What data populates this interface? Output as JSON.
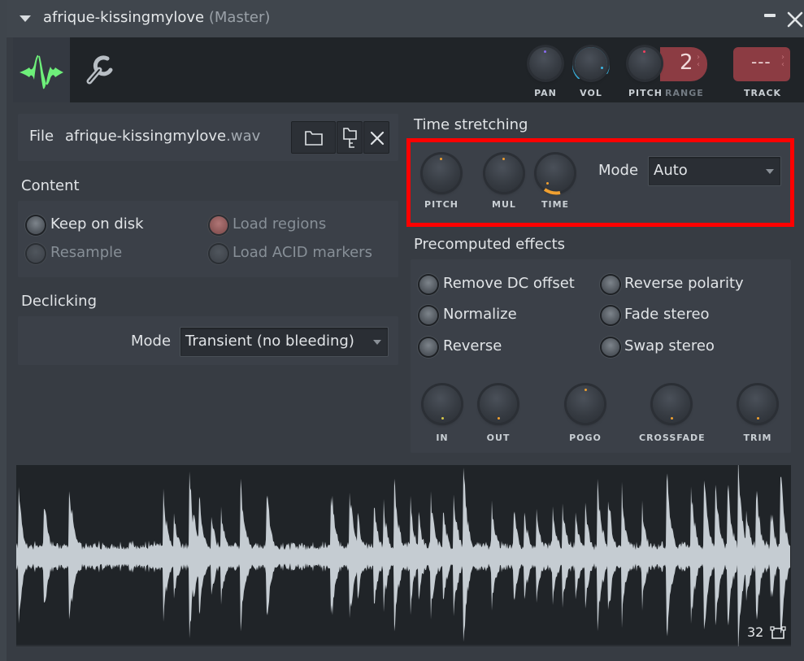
{
  "window": {
    "title": "afrique-kissingmylove",
    "title_suffix": "(Master)"
  },
  "toolbar": {
    "tabs": [
      {
        "name": "sample-tab",
        "icon": "waveform-icon",
        "active": true
      },
      {
        "name": "tools-tab",
        "icon": "wrench-icon",
        "active": false
      }
    ],
    "knobs": [
      {
        "label": "PAN",
        "value": 0
      },
      {
        "label": "VOL",
        "value": 0.78
      },
      {
        "label": "PITCH",
        "value": 0
      }
    ],
    "range_label": "RANGE",
    "range_value": "2",
    "track_label": "TRACK",
    "track_value": "---"
  },
  "file": {
    "label": "File",
    "name": "afrique-kissingmylove",
    "ext": ".wav",
    "buttons": [
      "open-folder",
      "browse-folder",
      "remove"
    ]
  },
  "content": {
    "title": "Content",
    "options": [
      {
        "label": "Keep on disk",
        "enabled": true,
        "checked": false
      },
      {
        "label": "Load regions",
        "enabled": false,
        "checked": true
      },
      {
        "label": "Resample",
        "enabled": false,
        "checked": false
      },
      {
        "label": "Load ACID markers",
        "enabled": false,
        "checked": false
      }
    ]
  },
  "declicking": {
    "title": "Declicking",
    "mode_label": "Mode",
    "mode_value": "Transient (no bleeding)"
  },
  "time_stretching": {
    "title": "Time stretching",
    "knobs": [
      {
        "label": "PITCH",
        "value": 0
      },
      {
        "label": "MUL",
        "value": 0
      },
      {
        "label": "TIME",
        "value": 0
      }
    ],
    "mode_label": "Mode",
    "mode_value": "Auto"
  },
  "precomputed": {
    "title": "Precomputed effects",
    "options": [
      {
        "label": "Remove DC offset",
        "checked": false
      },
      {
        "label": "Reverse polarity",
        "checked": false
      },
      {
        "label": "Normalize",
        "checked": false
      },
      {
        "label": "Fade stereo",
        "checked": false
      },
      {
        "label": "Reverse",
        "checked": false
      },
      {
        "label": "Swap stereo",
        "checked": false
      }
    ],
    "knobs": [
      {
        "label": "IN",
        "value": 0
      },
      {
        "label": "OUT",
        "value": 0
      },
      {
        "label": "POGO",
        "value": 0.5
      },
      {
        "label": "CROSSFADE",
        "value": 0
      },
      {
        "label": "TRIM",
        "value": 0
      }
    ]
  },
  "waveform": {
    "zoom_value": "32"
  },
  "colors": {
    "accent_green": "#6ef07a",
    "vol_ring": "#3bb8e6",
    "knob_dot": "#f0a030",
    "display_red": "#8c3c43",
    "highlight": "#ff0000"
  }
}
